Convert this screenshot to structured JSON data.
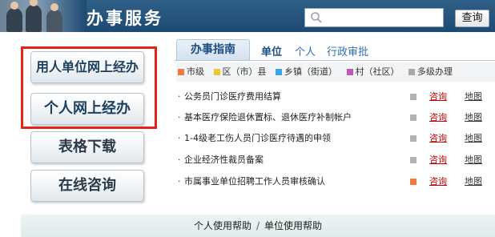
{
  "header": {
    "title": "办事服务",
    "search": {
      "placeholder": "",
      "icon": "search-icon"
    },
    "search_button_label": "查询"
  },
  "left_buttons": [
    {
      "label": "用人单位网上经办",
      "highlighted": true
    },
    {
      "label": "个人网上经办",
      "highlighted": true
    },
    {
      "label": "表格下载",
      "highlighted": false
    },
    {
      "label": "在线咨询",
      "highlighted": false
    }
  ],
  "tabs": [
    {
      "label": "办事指南",
      "active": true
    },
    {
      "label": "单位",
      "active": false
    },
    {
      "label": "个人",
      "active": false
    },
    {
      "label": "行政审批",
      "active": false
    }
  ],
  "legend": [
    {
      "label": "市级",
      "color": "#f07b3f"
    },
    {
      "label": "区（市）县",
      "color": "#f4c32d"
    },
    {
      "label": "乡镇（街道）",
      "color": "#3aa3e3"
    },
    {
      "label": "村（社区）",
      "color": "#c05ab8"
    },
    {
      "label": "多级办理",
      "color": "#a9a9a9"
    }
  ],
  "items": [
    {
      "title": "公务员门诊医疗费用结算",
      "level_color": "#b3b3b3",
      "consult": "咨询",
      "map": "地图"
    },
    {
      "title": "基本医疗保险退休置标、退休医疗补制帐户",
      "level_color": "#b3b3b3",
      "consult": "咨询",
      "map": "地图"
    },
    {
      "title": "1-4级老工伤人员门诊医疗待遇的申领",
      "level_color": "#b3b3b3",
      "consult": "咨询",
      "map": "地图"
    },
    {
      "title": "企业经济性裁员备案",
      "level_color": "#b3b3b3",
      "consult": "咨询",
      "map": "地图"
    },
    {
      "title": "市属事业单位招聘工作人员审核确认",
      "level_color": "#f07b3f",
      "consult": "咨询",
      "map": "地图"
    }
  ],
  "footer": {
    "personal_help": "个人使用帮助",
    "separator": "/",
    "unit_help": "单位使用帮助"
  }
}
